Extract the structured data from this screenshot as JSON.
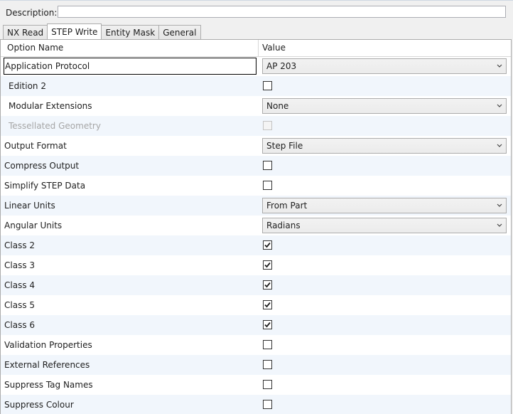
{
  "description": {
    "label": "Description:",
    "value": ""
  },
  "tabs": [
    {
      "label": "NX Read",
      "active": false
    },
    {
      "label": "STEP Write",
      "active": true
    },
    {
      "label": "Entity Mask",
      "active": false
    },
    {
      "label": "General",
      "active": false
    }
  ],
  "grid": {
    "headers": {
      "option_name": "Option Name",
      "value": "Value"
    },
    "rows": [
      {
        "name": "Application Protocol",
        "type": "dropdown",
        "value": "AP 203",
        "selected": true
      },
      {
        "name": "Edition 2",
        "type": "checkbox",
        "checked": false,
        "indent": true
      },
      {
        "name": "Modular Extensions",
        "type": "dropdown",
        "value": "None",
        "indent": true
      },
      {
        "name": "Tessellated Geometry",
        "type": "checkbox",
        "checked": false,
        "indent": true,
        "disabled": true
      },
      {
        "name": "Output Format",
        "type": "dropdown",
        "value": "Step File"
      },
      {
        "name": "Compress Output",
        "type": "checkbox",
        "checked": false
      },
      {
        "name": "Simplify STEP Data",
        "type": "checkbox",
        "checked": false
      },
      {
        "name": "Linear Units",
        "type": "dropdown",
        "value": "From Part"
      },
      {
        "name": "Angular Units",
        "type": "dropdown",
        "value": "Radians"
      },
      {
        "name": "Class 2",
        "type": "checkbox",
        "checked": true
      },
      {
        "name": "Class 3",
        "type": "checkbox",
        "checked": true
      },
      {
        "name": "Class 4",
        "type": "checkbox",
        "checked": true
      },
      {
        "name": "Class 5",
        "type": "checkbox",
        "checked": true
      },
      {
        "name": "Class 6",
        "type": "checkbox",
        "checked": true
      },
      {
        "name": "Validation Properties",
        "type": "checkbox",
        "checked": false
      },
      {
        "name": "External References",
        "type": "checkbox",
        "checked": false
      },
      {
        "name": "Suppress Tag Names",
        "type": "checkbox",
        "checked": false
      },
      {
        "name": "Suppress Colour",
        "type": "checkbox",
        "checked": false
      }
    ]
  },
  "icons": {
    "dropdown": "chevron-down-icon",
    "check": "checkmark-icon"
  },
  "colors": {
    "alt_row": "#f1f6fc",
    "border": "#acacac",
    "disabled_text": "#a6a6a6"
  }
}
